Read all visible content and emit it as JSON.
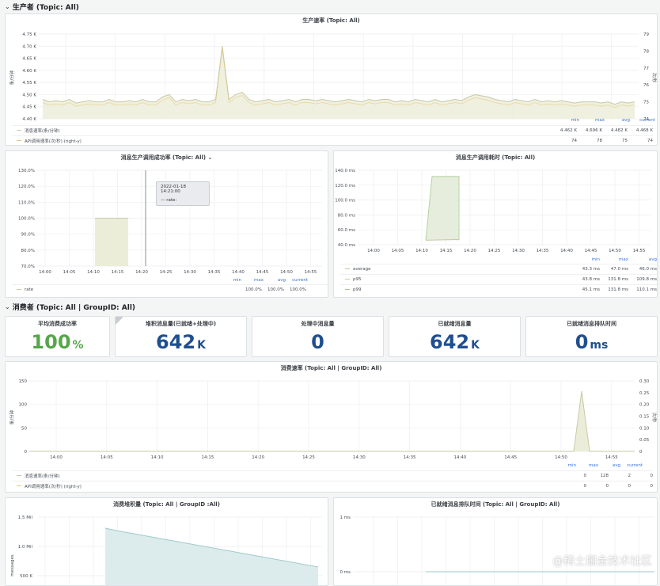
{
  "rows": {
    "producer": "生产者 (Topic: All)",
    "consumer": "消费者 (Topic: All | GroupID: All)"
  },
  "produce_rate": {
    "title": "生产速率 (Topic: All)",
    "y_label": "条/分钟",
    "y_right_label": "次/秒",
    "y_ticks": [
      "4.75 K",
      "4.70 K",
      "4.65 K",
      "4.60 K",
      "4.55 K",
      "4.50 K",
      "4.45 K",
      "4.40 K"
    ],
    "y_right_ticks": [
      "79",
      "78",
      "77",
      "76",
      "75",
      "74"
    ],
    "x_ticks": [
      "14:00",
      "14:05",
      "14:10",
      "14:15",
      "14:20",
      "14:25",
      "14:30",
      "14:35",
      "14:40",
      "14:45",
      "14:50",
      "14:55"
    ],
    "legend_headers": [
      "min",
      "max",
      "avg",
      "current"
    ],
    "series": [
      {
        "name": "消息速率(条/分钟)",
        "tag": "",
        "color": "#c7c9a6",
        "stats": [
          "4.462 K",
          "4.696 K",
          "4.482 K",
          "4.468 K"
        ]
      },
      {
        "name": "API调用速率(次/秒)",
        "tag": "(right-y)",
        "color": "#e6c97a",
        "stats": [
          "74",
          "78",
          "75",
          "74"
        ]
      }
    ]
  },
  "produce_success": {
    "title": "消息生产调用成功率 (Topic: All)",
    "dropdown": "⌄",
    "y_ticks": [
      "130.0%",
      "120.0%",
      "110.0%",
      "100.0%",
      "90.0%",
      "80.0%",
      "70.0%"
    ],
    "x_ticks": [
      "14:00",
      "14:05",
      "14:10",
      "14:15",
      "14:20",
      "14:25",
      "14:30",
      "14:35",
      "14:40",
      "14:45",
      "14:50",
      "14:55"
    ],
    "legend_headers": [
      "min",
      "max",
      "avg",
      "current"
    ],
    "series": [
      {
        "name": "rate",
        "color": "#c7c9a6",
        "stats": [
          "100.0%",
          "100.0%",
          "100.0%",
          ""
        ]
      }
    ],
    "tooltip": {
      "time": "2022-01-18 14:21:00",
      "line": "— rate:"
    }
  },
  "produce_latency": {
    "title": "消息生产调用耗时 (Topic: All)",
    "y_ticks": [
      "140.0 ms",
      "120.0 ms",
      "100.0 ms",
      "80.0 ms",
      "60.0 ms",
      "40.0 ms"
    ],
    "x_ticks": [
      "14:00",
      "14:05",
      "14:10",
      "14:15",
      "14:20",
      "14:25",
      "14:30",
      "14:35",
      "14:40",
      "14:45",
      "14:50",
      "14:55"
    ],
    "legend_headers": [
      "min",
      "max",
      "avg"
    ],
    "series": [
      {
        "name": "average",
        "color": "#c7c9a6",
        "stats": [
          "43.3 ms",
          "47.0 ms",
          "46.0 ms"
        ]
      },
      {
        "name": "p95",
        "color": "#b7d3a0",
        "stats": [
          "43.8 ms",
          "131.8 ms",
          "109.8 ms"
        ]
      },
      {
        "name": "p99",
        "color": "#a8c98c",
        "stats": [
          "45.1 ms",
          "131.8 ms",
          "110.1 ms"
        ]
      }
    ]
  },
  "stats": [
    {
      "title": "平均消费成功率",
      "value": "100",
      "unit": "%",
      "color": "#56a64b"
    },
    {
      "title": "堆积消息量(已就绪+处理中)",
      "value": "642",
      "unit": "K",
      "color": "#1f4f8f",
      "corner": "i"
    },
    {
      "title": "处理中消息量",
      "value": "0",
      "unit": "",
      "color": "#1f4f8f"
    },
    {
      "title": "已就绪消息量",
      "value": "642",
      "unit": "K",
      "color": "#1f4f8f"
    },
    {
      "title": "已就绪消息排队时间",
      "value": "0",
      "unit": "ms",
      "color": "#1f4f8f"
    }
  ],
  "consume_rate": {
    "title": "消费速率 (Topic: All | GroupID: All)",
    "y_label": "条/分钟",
    "y_right_label": "次/秒",
    "y_ticks": [
      "150",
      "100",
      "50",
      "0"
    ],
    "y_right_ticks": [
      "0.30",
      "0.25",
      "0.20",
      "0.15",
      "0.10",
      "0.05",
      "0"
    ],
    "x_ticks": [
      "14:00",
      "14:05",
      "14:10",
      "14:15",
      "14:20",
      "14:25",
      "14:30",
      "14:35",
      "14:40",
      "14:45",
      "14:50",
      "14:55"
    ],
    "legend_headers": [
      "min",
      "max",
      "avg",
      "current"
    ],
    "series": [
      {
        "name": "消息速率(条/分钟)",
        "tag": "",
        "color": "#c7c9a6",
        "stats": [
          "0",
          "128",
          "2",
          "0"
        ]
      },
      {
        "name": "API调用速率(次/秒)",
        "tag": "(right-y)",
        "color": "#e6c97a",
        "stats": [
          "0",
          "0",
          "0",
          "0"
        ]
      }
    ]
  },
  "backlog": {
    "title": "消费堆积量 (Topic: All | GroupID :All)",
    "y_label": "messages",
    "y_ticks": [
      "1.5 Mil",
      "1.0 Mil",
      "500 K"
    ]
  },
  "queue_time": {
    "title": "已就绪消息排队时间 (Topic: All | GroupID: All)",
    "y_ticks": [
      "1 ms",
      "0 ms"
    ]
  },
  "watermark": "@稀土掘金技术社区"
}
